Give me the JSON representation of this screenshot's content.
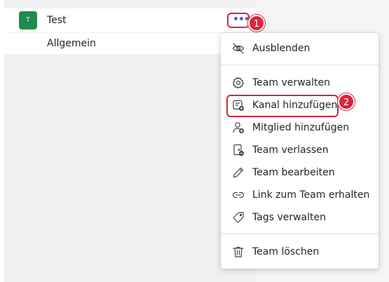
{
  "sidebar": {
    "team": {
      "avatar_initial": "T",
      "name": "Test",
      "more_options_glyph": "•••",
      "avatar_color": "#1f8b4c"
    },
    "channels": [
      {
        "name": "Allgemein"
      }
    ]
  },
  "callouts": {
    "step1": "1",
    "step2": "2",
    "color": "#d7263d"
  },
  "context_menu": {
    "items": [
      {
        "label": "Ausblenden",
        "icon": "eye-off-icon"
      },
      {
        "label": "Team verwalten",
        "icon": "gear-icon"
      },
      {
        "label": "Kanal hinzufügen",
        "icon": "add-channel-icon"
      },
      {
        "label": "Mitglied hinzufügen",
        "icon": "add-person-icon"
      },
      {
        "label": "Team verlassen",
        "icon": "leave-door-icon"
      },
      {
        "label": "Team bearbeiten",
        "icon": "pencil-icon"
      },
      {
        "label": "Link zum Team erhalten",
        "icon": "link-icon"
      },
      {
        "label": "Tags verwalten",
        "icon": "tag-icon"
      },
      {
        "label": "Team löschen",
        "icon": "trash-icon"
      }
    ]
  }
}
